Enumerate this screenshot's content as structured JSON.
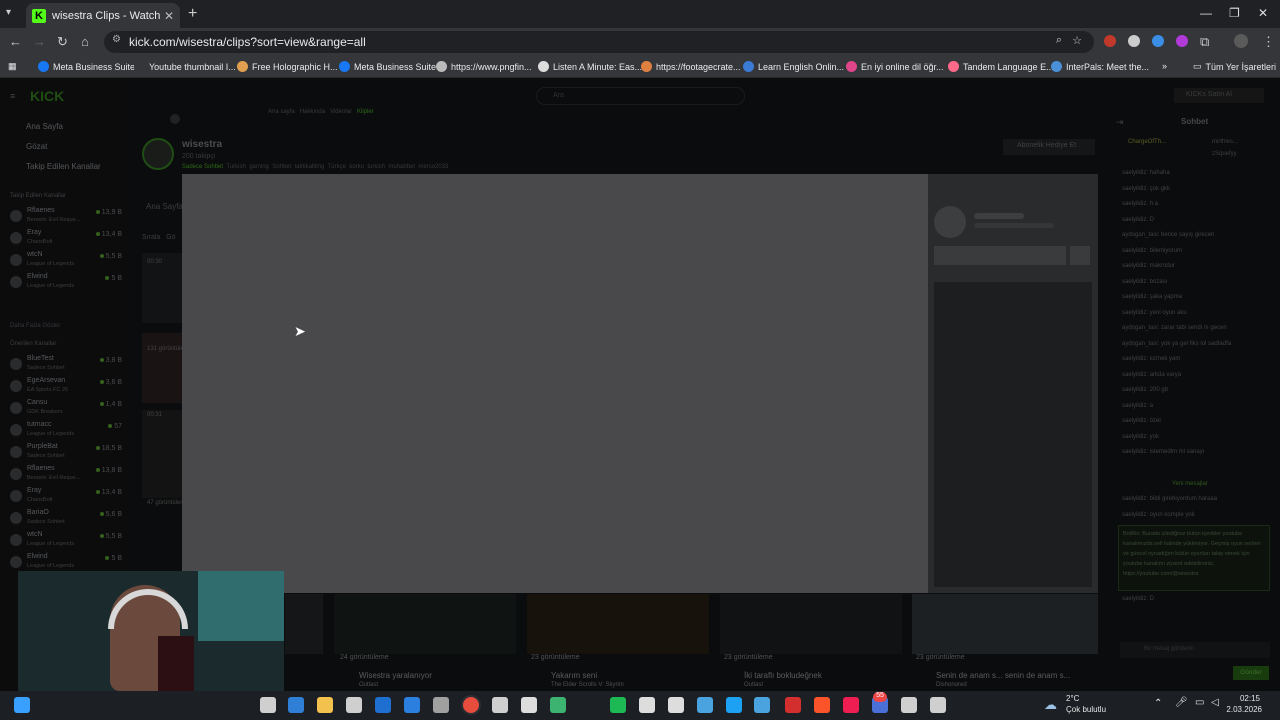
{
  "browser": {
    "tab_title": "wisestra Clips - Watch Live on K",
    "tab_favicon": "K",
    "url": "kick.com/wisestra/clips?sort=view&range=all",
    "bookmarks": [
      {
        "label": "Meta Business Suite",
        "color": "#1877f2"
      },
      {
        "label": "Youtube thumbnail I...",
        "color": "#35363a"
      },
      {
        "label": "Free Holographic H...",
        "color": "#e0a050"
      },
      {
        "label": "Meta Business Suite",
        "color": "#1877f2"
      },
      {
        "label": "https://www.pngfin...",
        "color": "#bbbbbb"
      },
      {
        "label": "Listen A Minute: Eas...",
        "color": "#dddddd"
      },
      {
        "label": "https://footagecrate...",
        "color": "#e08040"
      },
      {
        "label": "Learn English Onlin...",
        "color": "#3a7bd5"
      },
      {
        "label": "En iyi online dil öğr...",
        "color": "#e0458a"
      },
      {
        "label": "Tandem Language E...",
        "color": "#ff6a8a"
      },
      {
        "label": "InterPals: Meet the...",
        "color": "#4a90d9"
      }
    ],
    "all_bookmarks": "Tüm Yer İşaretleri"
  },
  "kick": {
    "logo": "KICK",
    "search_placeholder": "Ara",
    "get_kicks": "KICKs Satın Al",
    "nav": [
      "Ana Sayfa",
      "Gözat",
      "Takip Edilen Kanallar"
    ],
    "followed_title": "Takip Edilen Kanallar",
    "followed": [
      {
        "name": "Rflaenes",
        "game": "Berserk: Evil Reque...",
        "viewers": "13,9 B"
      },
      {
        "name": "Eray",
        "game": "ChaosBolt",
        "viewers": "13,4 B"
      },
      {
        "name": "wtcN",
        "game": "League of Legends",
        "viewers": "5,5 B"
      },
      {
        "name": "Elwind",
        "game": "League of Legends",
        "viewers": "5 B"
      }
    ],
    "more": "Daha Fazla Göster",
    "recommended_title": "Önerilen Kanallar",
    "recommended": [
      {
        "name": "BlueTest",
        "game": "Sadece Sohbet",
        "viewers": "3,8 B"
      },
      {
        "name": "EgeArsevan",
        "game": "EA Sports FC 26",
        "viewers": "3,6 B"
      },
      {
        "name": "Cansu",
        "game": "GDK Breakers",
        "viewers": "1,4 B"
      },
      {
        "name": "tutmacc",
        "game": "League of Legends",
        "viewers": "57"
      },
      {
        "name": "PurpleBat",
        "game": "Sadece Sohbet",
        "viewers": "18,5 B"
      },
      {
        "name": "Rflaenes",
        "game": "Berserk: Evil Reque...",
        "viewers": "13,8 B"
      },
      {
        "name": "Eray",
        "game": "ChaosBolt",
        "viewers": "13,4 B"
      },
      {
        "name": "BariaO",
        "game": "Sadece Sohbet",
        "viewers": "5,6 B"
      },
      {
        "name": "wtcN",
        "game": "League of Legends",
        "viewers": "5,5 B"
      },
      {
        "name": "Elwind",
        "game": "League of Legends",
        "viewers": "5 B"
      }
    ],
    "channel": {
      "name": "wisestra",
      "followers": "200 takipçi",
      "tags": [
        "Sadece Sohbet",
        "Turkish",
        "gaming",
        "Sohbet",
        "taktikaltling",
        "Türkçe",
        "korku",
        "turkish",
        "muhabbet",
        "merso2033"
      ],
      "gift_button": "Abonelik Hediye Et",
      "tabs": [
        "Ana sayfa",
        "Hakkında",
        "Videolar",
        "Klipler"
      ],
      "home_label": "Ana Sayfa",
      "sort_labels": [
        "Sırala",
        "Gö"
      ]
    },
    "clips": [
      {
        "views": "24 görüntüleme",
        "title": "Wisestra yaralanıyor",
        "game": "Outlast"
      },
      {
        "views": "23 görüntüleme",
        "title": "Yakarım seni",
        "game": "The Elder Scrolls V: Skyrim"
      },
      {
        "views": "23 görüntüleme",
        "title": "İki taraflı bokludeğnek",
        "game": "Outlast"
      },
      {
        "views": "23 görüntüleme",
        "title": "Senin de anam s... senin de anam s...",
        "game": "Dishonored"
      }
    ],
    "left_clips": [
      {
        "views": "131 görüntüleme",
        "duration": "00:30"
      },
      {
        "views": "47 görüntüleme",
        "duration": "00:31"
      }
    ],
    "chat": {
      "title": "Sohbet",
      "new_messages": "Yeni mesajlar",
      "messages": [
        "saelyildiz: hahaha",
        "saelyildiz: çok gkk",
        "saelyildiz: h a",
        "saelyildiz: D",
        "aydogan_tasi: bence sayış girecen",
        "saelyildiz: bilemiyorum",
        "saelyildiz: makrodur",
        "saelyildiz: bozası",
        "saelyildiz: şaka yapma",
        "saelyildiz: yeni oyun aku",
        "aydogan_tasi: zarar tabi sendi nı gecen",
        "aydogan_tasi: yok ya gel fiks lol sadfadfa",
        "saelyildiz: ezmek yam",
        "saelyildiz: arkda varya",
        "saelyildiz: 200 gb",
        "saelyildiz: a",
        "saelyildiz: özel",
        "saelyildiz: yok",
        "saelyildiz: istemedim mi sanayı"
      ],
      "after_new": [
        "saelyildiz: bildi girebiyordum haraaa",
        "saelyildiz: oyun komple yok"
      ],
      "bot_message": "BotRix: Burada izlediğiniz bütün içerikler youtube kanalımızda sell halinde yükleniyor. Geçmiş oyun serileri ve güncel oynadığım bütün oyunları takip etmek için youtube kanalımı ziyaret edebilirsiniz. https://youtube.com/@wisestra",
      "last": "saelyildiz: D",
      "input_placeholder": "Bir mesaj gönderin",
      "send": "Gönder",
      "top_users": [
        "ChargeOfTh...",
        "mirthles...",
        "zSquefyy"
      ]
    }
  },
  "taskbar": {
    "weather_temp": "2°C",
    "weather_desc": "Çok bulutlu",
    "time": "02:15",
    "date": "2.03.2026",
    "badge": "55",
    "icons": [
      "windows",
      "search",
      "edge",
      "explorer",
      "store",
      "outlook",
      "outlook2",
      "calculator",
      "chrome",
      "steam",
      "epic",
      "xbox",
      "spotify",
      "obs",
      "unity",
      "globe",
      "twitter",
      "messenger",
      "opera",
      "brave",
      "tiktok",
      "teams",
      "app",
      "steam2"
    ]
  }
}
